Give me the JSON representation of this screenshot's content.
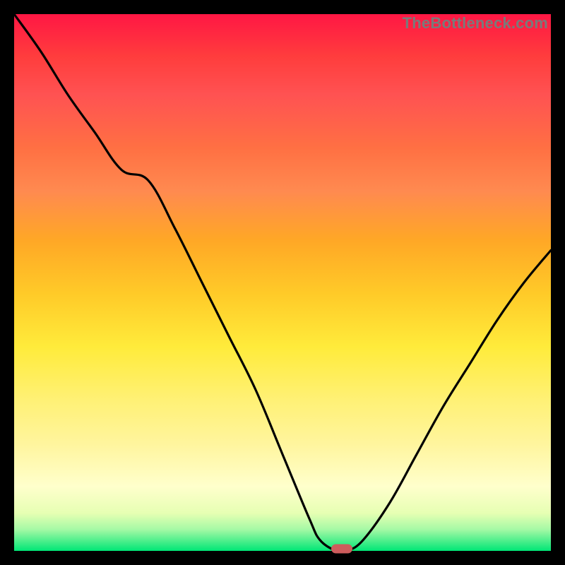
{
  "watermark": "TheBottleneck.com",
  "colors": {
    "background": "#000000",
    "curve": "#000000",
    "marker": "#cd5c5c",
    "gradient_top": "#ff1744",
    "gradient_bottom": "#00e676"
  },
  "chart_data": {
    "type": "line",
    "title": "",
    "xlabel": "",
    "ylabel": "",
    "xlim": [
      0,
      100
    ],
    "ylim": [
      0,
      100
    ],
    "x": [
      0,
      5,
      10,
      15,
      20,
      25,
      30,
      35,
      40,
      45,
      50,
      55,
      57,
      60,
      62,
      65,
      70,
      75,
      80,
      85,
      90,
      95,
      100
    ],
    "values": [
      100,
      93,
      85,
      78,
      71,
      69,
      60,
      50,
      40,
      30,
      18,
      6,
      2,
      0,
      0,
      2,
      9,
      18,
      27,
      35,
      43,
      50,
      56
    ],
    "marker": {
      "x": 61,
      "y": 0
    },
    "annotations": []
  }
}
